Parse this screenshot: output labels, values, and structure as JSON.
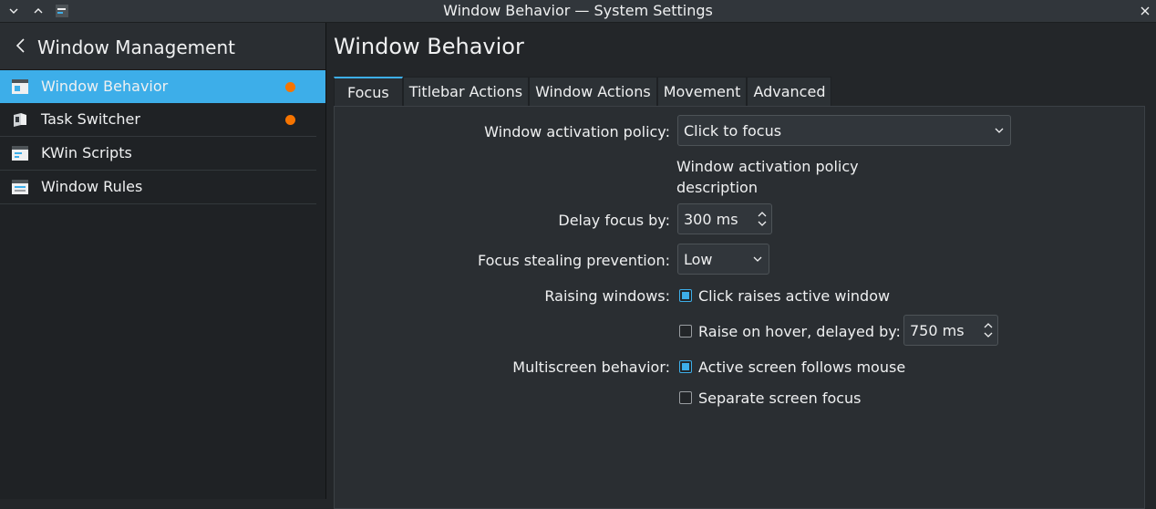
{
  "window": {
    "title": "Window Behavior — System Settings"
  },
  "sidebar": {
    "header": "Window Management",
    "items": [
      {
        "label": "Window Behavior",
        "icon": "window-behavior-icon",
        "active": true,
        "changed": true
      },
      {
        "label": "Task Switcher",
        "icon": "task-switcher-icon",
        "active": false,
        "changed": true
      },
      {
        "label": "KWin Scripts",
        "icon": "kwin-scripts-icon",
        "active": false,
        "changed": false
      },
      {
        "label": "Window Rules",
        "icon": "window-rules-icon",
        "active": false,
        "changed": false
      }
    ]
  },
  "main": {
    "title": "Window Behavior",
    "tabs": [
      {
        "label": "Focus",
        "active": true
      },
      {
        "label": "Titlebar Actions",
        "active": false
      },
      {
        "label": "Window Actions",
        "active": false
      },
      {
        "label": "Movement",
        "active": false
      },
      {
        "label": "Advanced",
        "active": false
      }
    ],
    "focus": {
      "activation_policy_label": "Window activation policy:",
      "activation_policy_value": "Click to focus",
      "activation_policy_description": "Window activation policy description",
      "delay_focus_label": "Delay focus by:",
      "delay_focus_value": "300 ms",
      "focus_stealing_label": "Focus stealing prevention:",
      "focus_stealing_value": "Low",
      "raising_label": "Raising windows:",
      "click_raises_label": "Click raises active window",
      "click_raises_checked": true,
      "raise_hover_label": "Raise on hover, delayed by:",
      "raise_hover_checked": false,
      "raise_hover_delay": "750 ms",
      "multiscreen_label": "Multiscreen behavior:",
      "active_follows_mouse_label": "Active screen follows mouse",
      "active_follows_mouse_checked": true,
      "separate_focus_label": "Separate screen focus",
      "separate_focus_checked": false
    }
  },
  "colors": {
    "accent": "#3daee9",
    "changed_indicator": "#f67400",
    "background": "#232629"
  }
}
